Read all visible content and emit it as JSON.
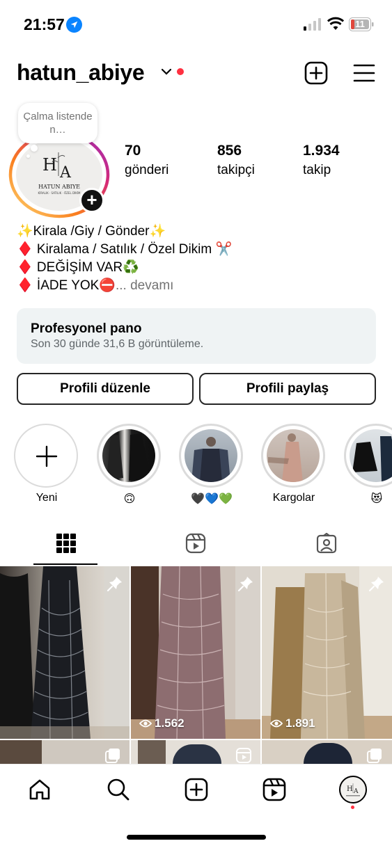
{
  "status_bar": {
    "time": "21:57",
    "battery": "11",
    "icons": [
      "location-arrow-icon",
      "cellular-signal-icon",
      "wifi-icon",
      "battery-icon"
    ]
  },
  "header": {
    "username": "hatun_abiye",
    "icons": [
      "chevron-down-icon",
      "create-plus-square-icon",
      "menu-hamburger-icon"
    ],
    "notification_dot_color": "#ff3040"
  },
  "profile": {
    "note": "Çalma listende n…",
    "avatar_logo": {
      "monogram": "HA",
      "name": "HATUN ABIYE",
      "tagline": "KİRALIK · SATILIK · ÖZEL DİKİM"
    },
    "avatar_ring_colors": [
      "#feda75",
      "#fa7e1e",
      "#d62976",
      "#962fbf"
    ],
    "stats": [
      {
        "value": "70",
        "label": "gönderi"
      },
      {
        "value": "856",
        "label": "takipçi"
      },
      {
        "value": "1.934",
        "label": "takip"
      }
    ],
    "bio_lines": [
      "✨Kirala /Giy / Gönder✨",
      "♦️ Kiralama / Satılık / Özel Dikim ✂️",
      "♦️ DEĞİŞİM VAR♻️",
      "♦️ İADE YOK⛔"
    ],
    "bio_more": "... devamı"
  },
  "pro_dashboard": {
    "title": "Profesyonel pano",
    "subtitle": "Son 30 günde 31,6 B görüntüleme."
  },
  "buttons": {
    "edit": "Profili düzenle",
    "share": "Profili paylaş"
  },
  "highlights": [
    {
      "label": "Yeni"
    },
    {
      "label": "🙃"
    },
    {
      "label": "🖤💙💚"
    },
    {
      "label": "Kargolar"
    },
    {
      "label": "😻"
    }
  ],
  "tabs": [
    "grid-icon",
    "reels-icon",
    "tagged-icon"
  ],
  "grid": [
    {
      "pinned": true,
      "views": ""
    },
    {
      "pinned": true,
      "views": "1.562"
    },
    {
      "pinned": true,
      "views": "1.891"
    },
    {
      "pinned": false,
      "type": "carousel"
    },
    {
      "pinned": false,
      "type": "reel"
    },
    {
      "pinned": false,
      "type": "carousel"
    }
  ],
  "bottom_nav": [
    "home-icon",
    "search-icon",
    "create-icon",
    "reels-icon",
    "profile-avatar"
  ],
  "colors": {
    "accent_red": "#ff3040",
    "pro_card_bg": "#eff3f4",
    "muted_text": "#737373"
  }
}
